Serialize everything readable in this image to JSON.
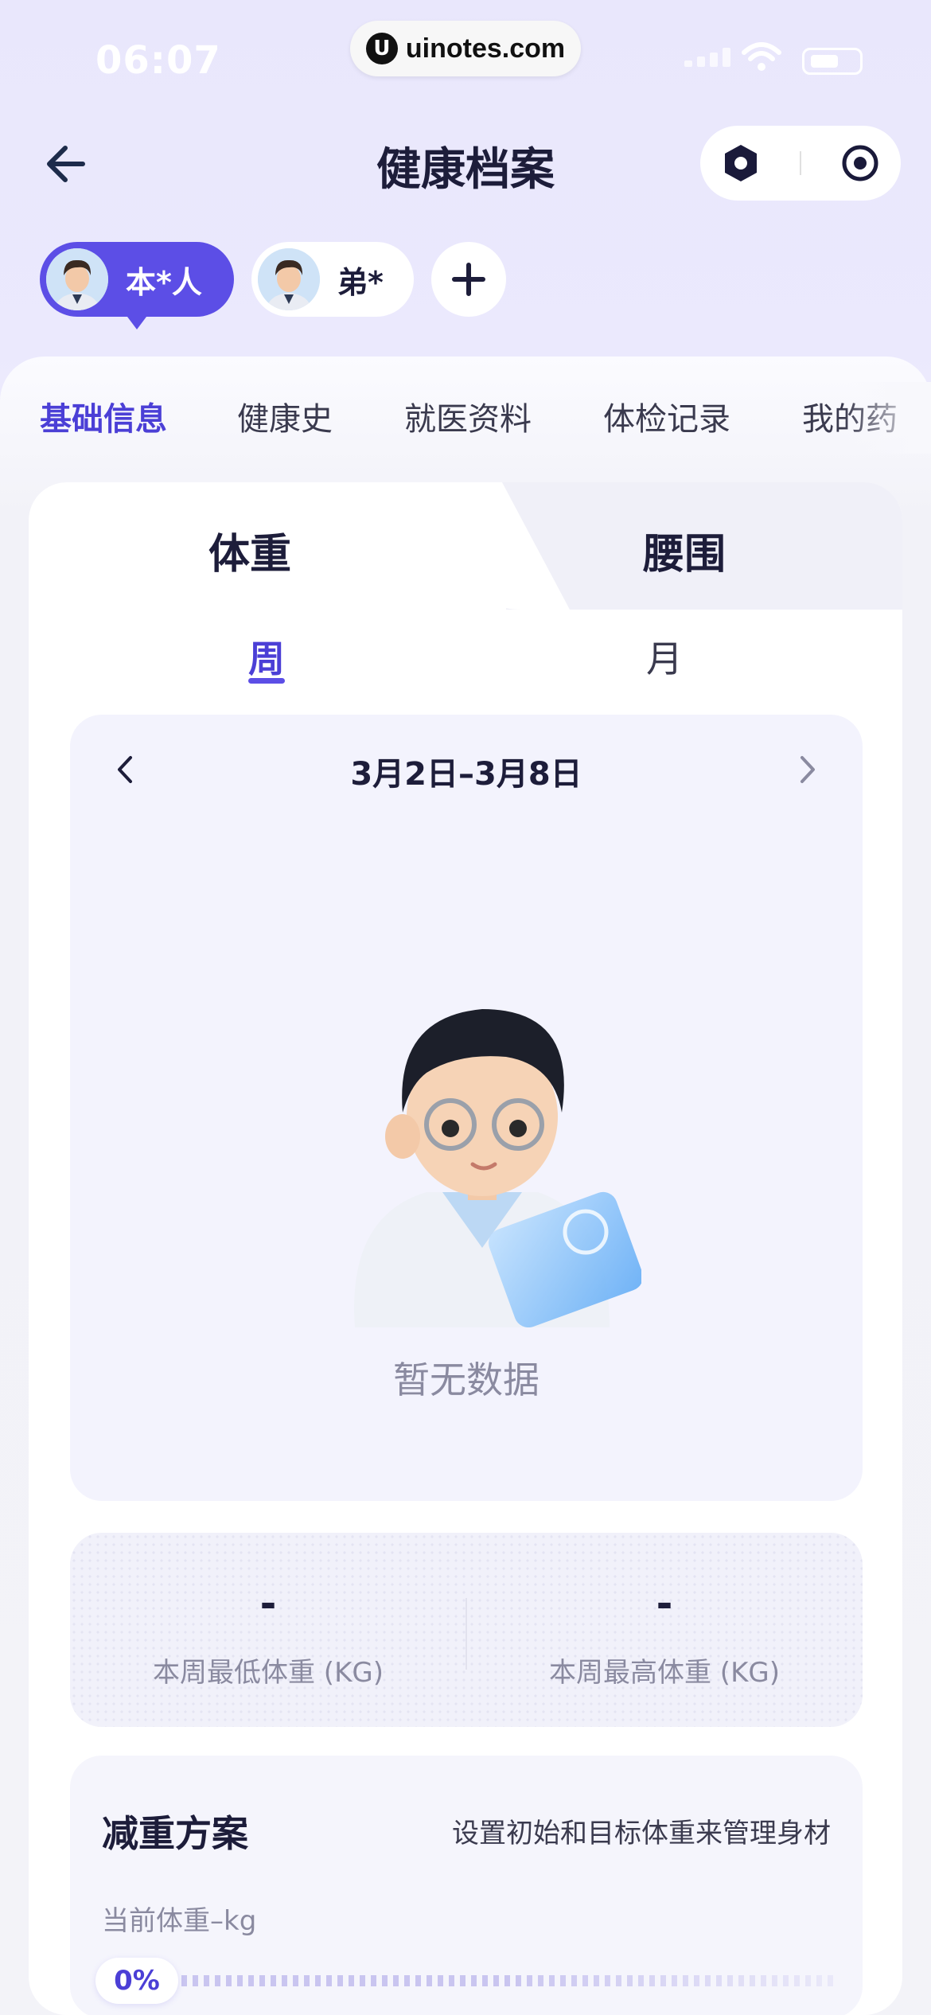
{
  "status_bar": {
    "time": "06:07"
  },
  "watermark": {
    "logo": "U",
    "text": "uinotes.com"
  },
  "nav": {
    "title": "健康档案"
  },
  "profiles": {
    "items": [
      {
        "name": "本*人",
        "active": true
      },
      {
        "name": "弟*",
        "active": false
      }
    ],
    "add_label": "+"
  },
  "tabs": [
    "基础信息",
    "健康史",
    "就医资料",
    "体检记录",
    "我的药"
  ],
  "active_tab": "基础信息",
  "measure_tabs": [
    "体重",
    "腰围"
  ],
  "period_tabs": [
    "周",
    "月"
  ],
  "chart": {
    "range": "3月2日–3月8日",
    "empty_text": "暂无数据"
  },
  "stats": {
    "min": {
      "value": "-",
      "label": "本周最低体重 (KG)"
    },
    "max": {
      "value": "-",
      "label": "本周最高体重 (KG)"
    }
  },
  "plan": {
    "title": "减重方案",
    "subtitle": "设置初始和目标体重来管理身材",
    "current_label": "当前体重–kg",
    "progress_label": "0%",
    "progress": 0
  },
  "colors": {
    "accent": "#5c4ee6",
    "accent_text": "#4b3fd6",
    "background": "#ebe9fd"
  },
  "icons": [
    "back-arrow-icon",
    "menu-dot-icon",
    "close-target-icon",
    "avatar-icon",
    "plus-icon",
    "chevron-left-icon",
    "chevron-right-icon"
  ]
}
